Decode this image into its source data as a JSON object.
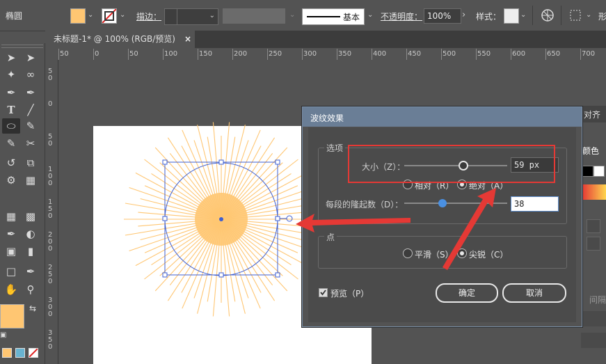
{
  "control_bar": {
    "tool_name": "椭圆",
    "stroke_label": "描边：",
    "stroke_profile": "基本",
    "opacity_label": "不透明度：",
    "opacity_value": "100%",
    "style_label": "样式：",
    "partial_right": "形",
    "fill_color": "#ffc672"
  },
  "document_tab": {
    "title": "未标题-1* @ 100% (RGB/预览)",
    "close": "×"
  },
  "ruler_h": [
    "50",
    "0",
    "50",
    "100",
    "150",
    "200",
    "250",
    "300",
    "350",
    "400",
    "450",
    "500",
    "550",
    "600",
    "650",
    "700"
  ],
  "ruler_v": [
    [
      "5",
      "0"
    ],
    [
      "0"
    ],
    [
      "5",
      "0"
    ],
    [
      "1",
      "0",
      "0"
    ],
    [
      "1",
      "5",
      "0"
    ],
    [
      "2",
      "0",
      "0"
    ],
    [
      "2",
      "5",
      "0"
    ],
    [
      "3",
      "0",
      "0"
    ],
    [
      "3",
      "5",
      "0"
    ]
  ],
  "dialog": {
    "title": "波纹效果",
    "options_label": "选项",
    "size_label": "大小（Z）：",
    "size_value": "59 px",
    "relative_label": "相对（R）",
    "absolute_label": "绝对（A）",
    "ridges_label": "每段的隆起数（D）：",
    "ridges_value": "38",
    "points_label": "点",
    "smooth_label": "平滑（S）",
    "corner_label": "尖锐（C）",
    "preview_label": "预览（P）",
    "ok_label": "确定",
    "cancel_label": "取消"
  },
  "right_panel": {
    "align_label": "对齐",
    "color_label": "颜色",
    "spacing_label": "间隔"
  },
  "colors": {
    "fill": "#ffc672",
    "highlight": "#e53935",
    "selection": "#3f5fd0",
    "slider_active": "#4a90e2"
  }
}
